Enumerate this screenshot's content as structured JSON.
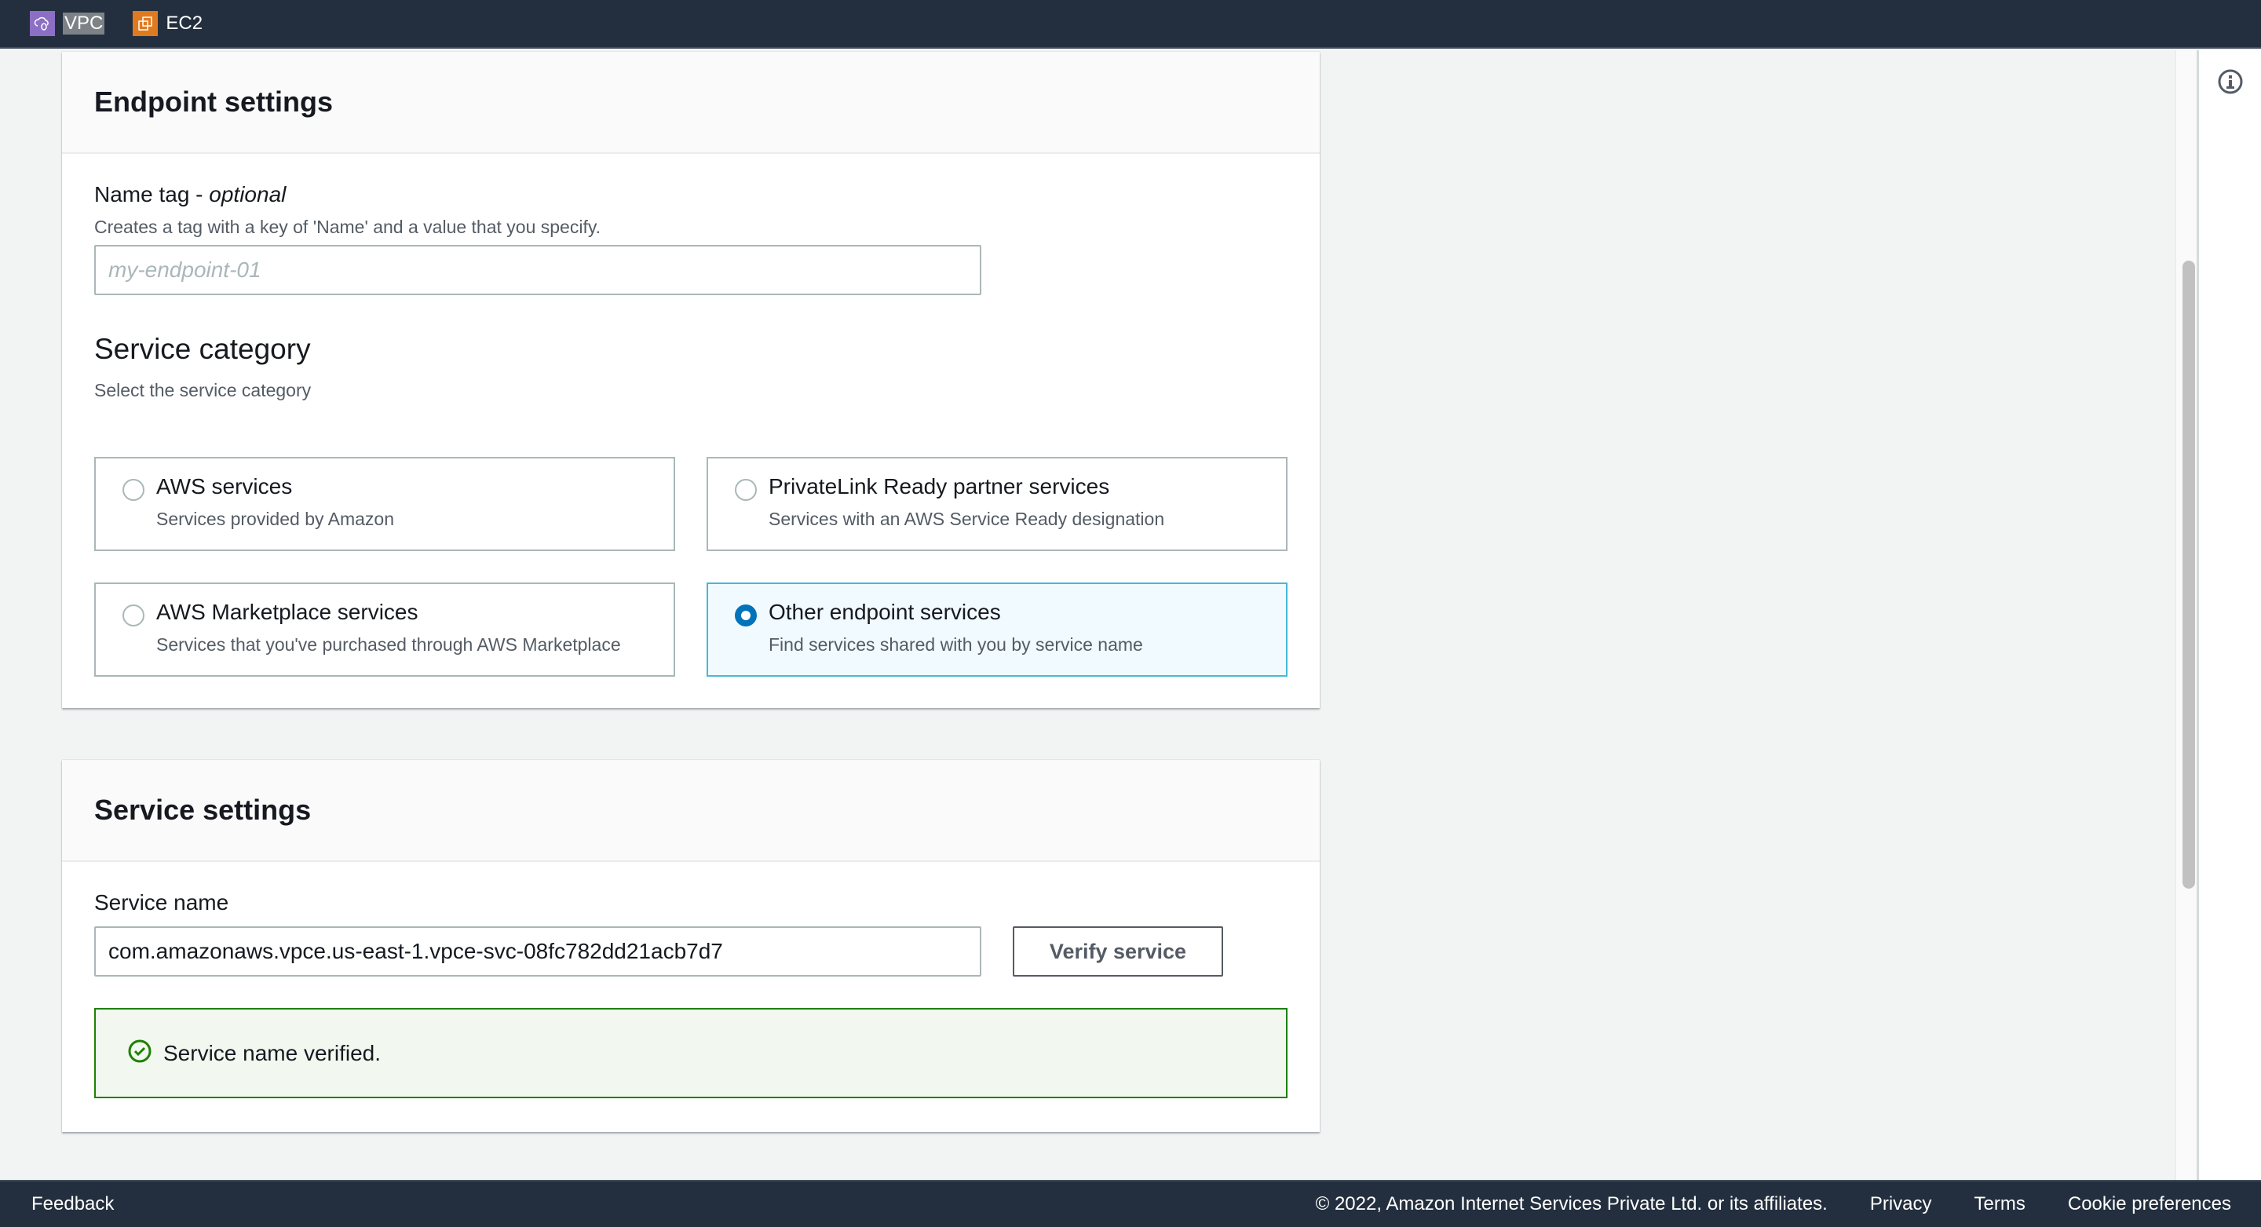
{
  "topbar": {
    "services": [
      {
        "label": "VPC",
        "icon": "vpc-icon",
        "color": "#8c6fc4"
      },
      {
        "label": "EC2",
        "icon": "ec2-icon",
        "color": "#e07a1f"
      }
    ]
  },
  "endpoint_settings": {
    "title": "Endpoint settings",
    "name_tag": {
      "label": "Name tag - ",
      "label_optional": "optional",
      "description": "Creates a tag with a key of 'Name' and a value that you specify.",
      "placeholder": "my-endpoint-01",
      "value": ""
    },
    "service_category": {
      "title": "Service category",
      "description": "Select the service category",
      "selected": "Other endpoint services",
      "options": [
        {
          "title": "AWS services",
          "description": "Services provided by Amazon",
          "selected": false
        },
        {
          "title": "PrivateLink Ready partner services",
          "description": "Services with an AWS Service Ready designation",
          "selected": false
        },
        {
          "title": "AWS Marketplace services",
          "description": "Services that you've purchased through AWS Marketplace",
          "selected": false
        },
        {
          "title": "Other endpoint services",
          "description": "Find services shared with you by service name",
          "selected": true
        }
      ]
    }
  },
  "service_settings": {
    "title": "Service settings",
    "service_name_label": "Service name",
    "service_name_value": "com.amazonaws.vpce.us-east-1.vpce-svc-08fc782dd21acb7d7",
    "verify_button": "Verify service",
    "alert": {
      "text": "Service name verified.",
      "type": "success",
      "color": "#1d8102"
    }
  },
  "footer": {
    "feedback": "Feedback",
    "copyright": "© 2022, Amazon Internet Services Private Ltd. or its affiliates.",
    "links": [
      "Privacy",
      "Terms",
      "Cookie preferences"
    ]
  },
  "colors": {
    "accent": "#0073bb",
    "selected_border": "#44b9d6",
    "nav_bg": "#232f3e"
  }
}
